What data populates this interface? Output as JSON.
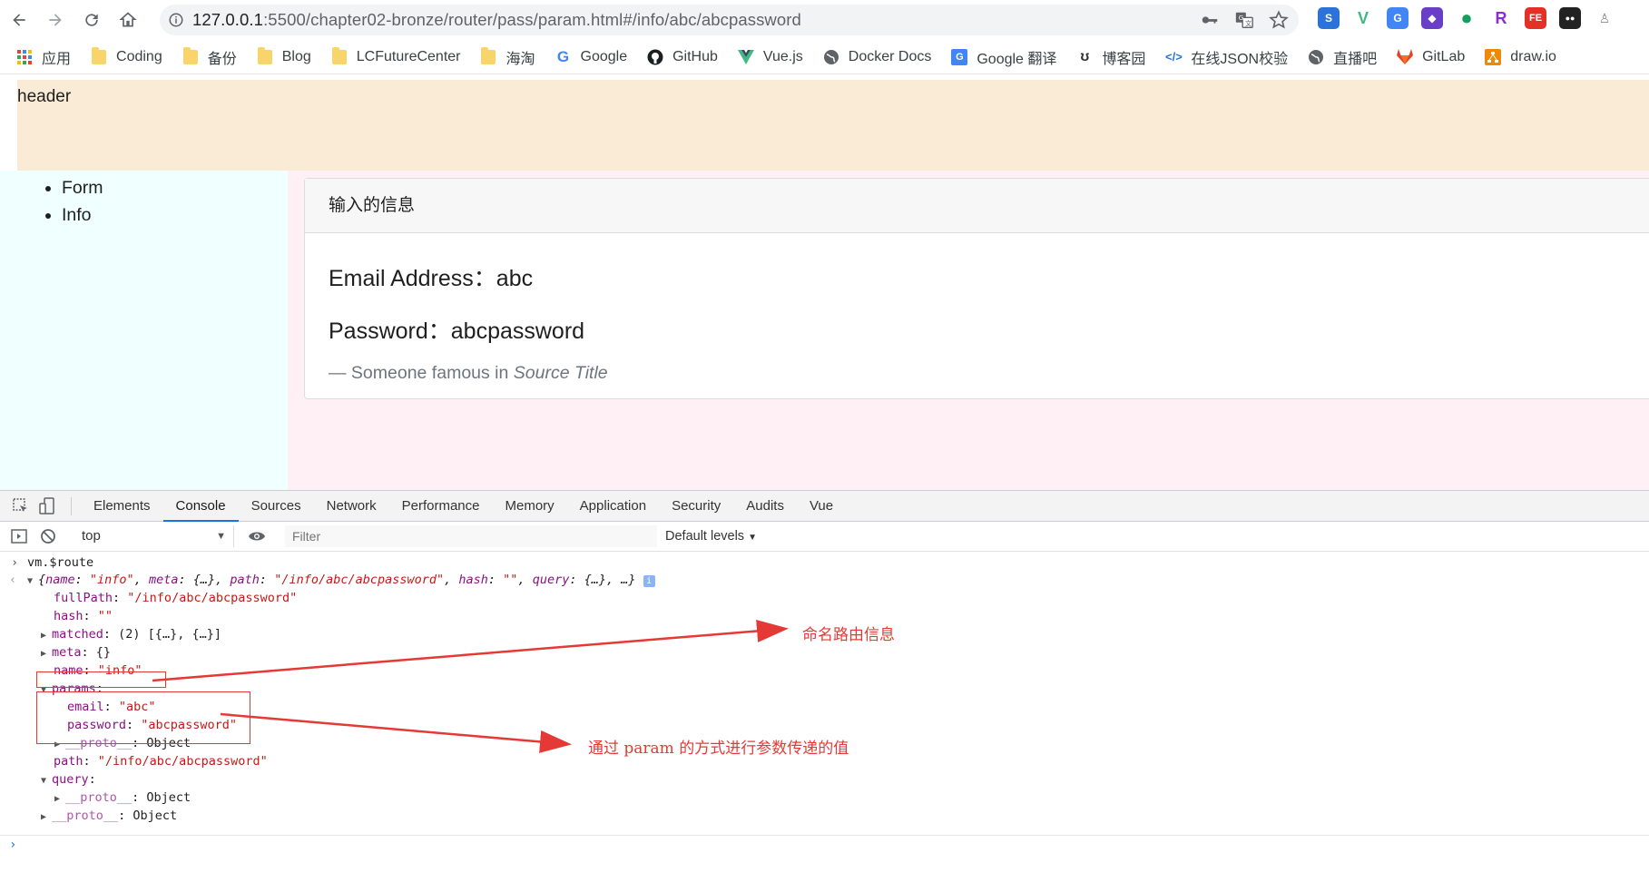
{
  "browser": {
    "url_host": "127.0.0.1",
    "url_rest": ":5500/chapter02-bronze/router/pass/param.html#/info/abc/abcpassword",
    "nav_icons": [
      "back-icon",
      "forward-icon",
      "reload-icon",
      "home-icon"
    ],
    "omnibox_icons": [
      "key-icon",
      "translate-icon",
      "star-icon"
    ],
    "extensions": [
      {
        "name": "sogou-ext-icon",
        "label": "S",
        "color": "#2b73d8"
      },
      {
        "name": "vue-ext-icon",
        "label": "V",
        "color": "#41b883"
      },
      {
        "name": "translate-ext-icon",
        "label": "G",
        "color": "#4285f4"
      },
      {
        "name": "cube-ext-icon",
        "label": "◆",
        "color": "#6a3fc7"
      },
      {
        "name": "green-dot-ext-icon",
        "label": "●",
        "color": "#12a05c"
      },
      {
        "name": "r-ext-icon",
        "label": "R",
        "color": "#8a2be2"
      },
      {
        "name": "fe-ext-icon",
        "label": "FE",
        "color": "#e33127"
      },
      {
        "name": "tampermonkey-ext-icon",
        "label": "●●",
        "color": "#222222"
      }
    ]
  },
  "bookmarks": [
    {
      "label": "应用",
      "icon": "apps-grid-icon"
    },
    {
      "label": "Coding",
      "icon": "folder-icon"
    },
    {
      "label": "备份",
      "icon": "folder-icon"
    },
    {
      "label": "Blog",
      "icon": "folder-icon"
    },
    {
      "label": "LCFutureCenter",
      "icon": "folder-icon"
    },
    {
      "label": "海淘",
      "icon": "folder-icon"
    },
    {
      "label": "Google",
      "icon": "google-icon"
    },
    {
      "label": "GitHub",
      "icon": "github-icon"
    },
    {
      "label": "Vue.js",
      "icon": "vue-icon"
    },
    {
      "label": "Docker Docs",
      "icon": "globe-icon"
    },
    {
      "label": "Google 翻译",
      "icon": "translate-icon"
    },
    {
      "label": "博客园",
      "icon": "cnblogs-icon"
    },
    {
      "label": "在线JSON校验",
      "icon": "code-icon"
    },
    {
      "label": "直播吧",
      "icon": "globe-icon"
    },
    {
      "label": "GitLab",
      "icon": "gitlab-icon"
    },
    {
      "label": "draw.io",
      "icon": "drawio-icon"
    }
  ],
  "page": {
    "header_text": "header",
    "nav": [
      "Form",
      "Info"
    ],
    "card": {
      "title": "输入的信息",
      "email_line": "Email Address：abc",
      "password_line": "Password：abcpassword",
      "footer_prefix": "— Someone famous in ",
      "footer_source": "Source Title"
    }
  },
  "devtools": {
    "tabs": [
      "Elements",
      "Console",
      "Sources",
      "Network",
      "Performance",
      "Memory",
      "Application",
      "Security",
      "Audits",
      "Vue"
    ],
    "active_tab": "Console",
    "context": "top",
    "filter_placeholder": "Filter",
    "levels": "Default levels",
    "console": {
      "input": "vm.$route",
      "summary": {
        "open": "{",
        "name_key": "name",
        "name_val": "\"info\"",
        "meta_key": "meta",
        "meta_val": "{…}",
        "path_key": "path",
        "path_val": "\"/info/abc/abcpassword\"",
        "hash_key": "hash",
        "hash_val": "\"\"",
        "query_key": "query",
        "query_val": "{…}",
        "close": "…}"
      },
      "props": {
        "fullPath_key": "fullPath",
        "fullPath_val": "\"/info/abc/abcpassword\"",
        "hash_key": "hash",
        "hash_val": "\"\"",
        "matched_key": "matched",
        "matched_val": "(2) [{…}, {…}]",
        "meta_key": "meta",
        "meta_val": "{}",
        "name_key": "name",
        "name_val": "\"info\"",
        "params_key": "params",
        "email_key": "email",
        "email_val": "\"abc\"",
        "password_key": "password",
        "password_val": "\"abcpassword\"",
        "proto_key": "__proto__",
        "proto_val": "Object",
        "path_key": "path",
        "path_val": "\"/info/abc/abcpassword\"",
        "query_key": "query"
      }
    },
    "annotations": {
      "named_route": "命名路由信息",
      "param_values": "通过 param 的方式进行参数传递的值"
    }
  }
}
